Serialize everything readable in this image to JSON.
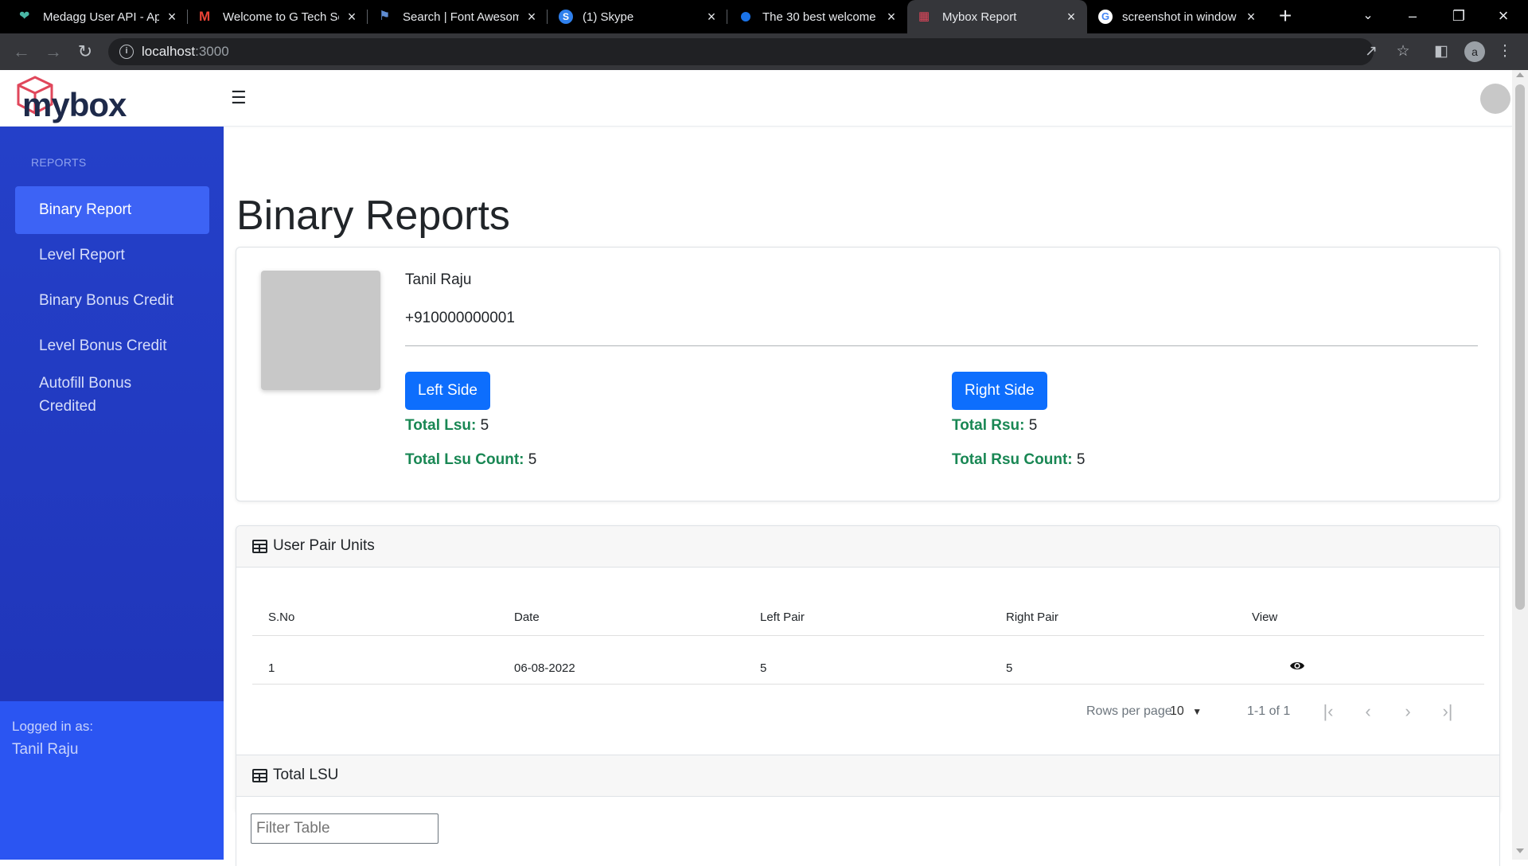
{
  "browser": {
    "tabs": [
      {
        "title": "Medagg User API - Ap",
        "icon": "heart-icon",
        "color": "#49b6a5"
      },
      {
        "title": "Welcome to G Tech So",
        "icon": "gmail-icon",
        "color": "#ea4335"
      },
      {
        "title": "Search | Font Awesom",
        "icon": "flag-icon",
        "color": "#5f8dd3"
      },
      {
        "title": "(1) Skype",
        "icon": "skype-icon",
        "color": "#2f80ed"
      },
      {
        "title": "The 30 best welcome",
        "icon": "globe-icon",
        "color": "#1a73e8"
      },
      {
        "title": "Mybox Report",
        "icon": "mybox-icon",
        "color": "#e0475b"
      },
      {
        "title": "screenshot in window",
        "icon": "google-icon",
        "color": "#4285f4"
      }
    ],
    "active_tab": 5,
    "url_host": "localhost",
    "url_port": ":3000",
    "profile_initial": "a"
  },
  "app": {
    "logo_text": "mybox",
    "menu_icon": "hamburger-icon"
  },
  "sidebar": {
    "section_title": "REPORTS",
    "items": [
      {
        "label": "Binary Report",
        "active": true
      },
      {
        "label": "Level Report",
        "active": false
      },
      {
        "label": "Binary Bonus Credit",
        "active": false
      },
      {
        "label": "Level Bonus Credit",
        "active": false
      },
      {
        "label": "Autofill Bonus Credited",
        "active": false
      }
    ],
    "logged_in_label": "Logged in as:",
    "logged_in_user": "Tanil Raju"
  },
  "main": {
    "title": "Binary Reports",
    "profile": {
      "name": "Tanil Raju",
      "phone": "+910000000001",
      "left": {
        "button": "Left Side",
        "total_label": "Total Lsu:",
        "total_value": "5",
        "count_label": "Total Lsu Count:",
        "count_value": "5"
      },
      "right": {
        "button": "Right Side",
        "total_label": "Total Rsu:",
        "total_value": "5",
        "count_label": "Total Rsu Count:",
        "count_value": "5"
      }
    },
    "pair_table": {
      "title": "User Pair Units",
      "columns": [
        "S.No",
        "Date",
        "Left Pair",
        "Right Pair",
        "View"
      ],
      "rows": [
        [
          "1",
          "06-08-2022",
          "5",
          "5"
        ]
      ],
      "rows_per_page_label": "Rows per page:",
      "rows_per_page": "10",
      "range": "1-1 of 1"
    },
    "lsu_table": {
      "title": "Total LSU",
      "filter_placeholder": "Filter Table"
    }
  },
  "colors": {
    "sidebar": "#1f33b6",
    "sidebar_active": "#3d63f5",
    "primary_button": "#0d6efd",
    "stat_label": "#198754"
  }
}
